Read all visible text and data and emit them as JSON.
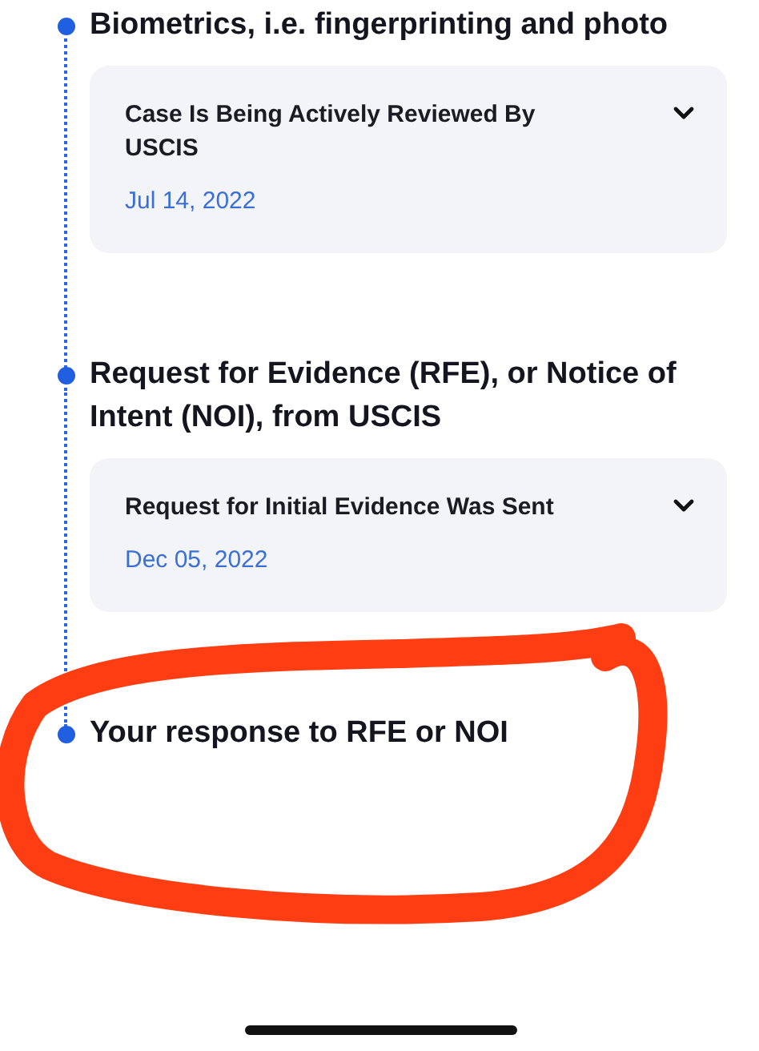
{
  "steps": [
    {
      "title": "Biometrics, i.e. fingerprinting and photo",
      "card": {
        "title": "Case Is Being Actively Reviewed By USCIS",
        "date": "Jul 14, 2022",
        "expanded": false
      }
    },
    {
      "title": "Request for Evidence (RFE), or Notice of Intent (NOI), from USCIS",
      "card": {
        "title": "Request for Initial Evidence Was Sent",
        "date": "Dec 05, 2022",
        "expanded": false
      }
    },
    {
      "title": "Your response to RFE or NOI"
    }
  ]
}
